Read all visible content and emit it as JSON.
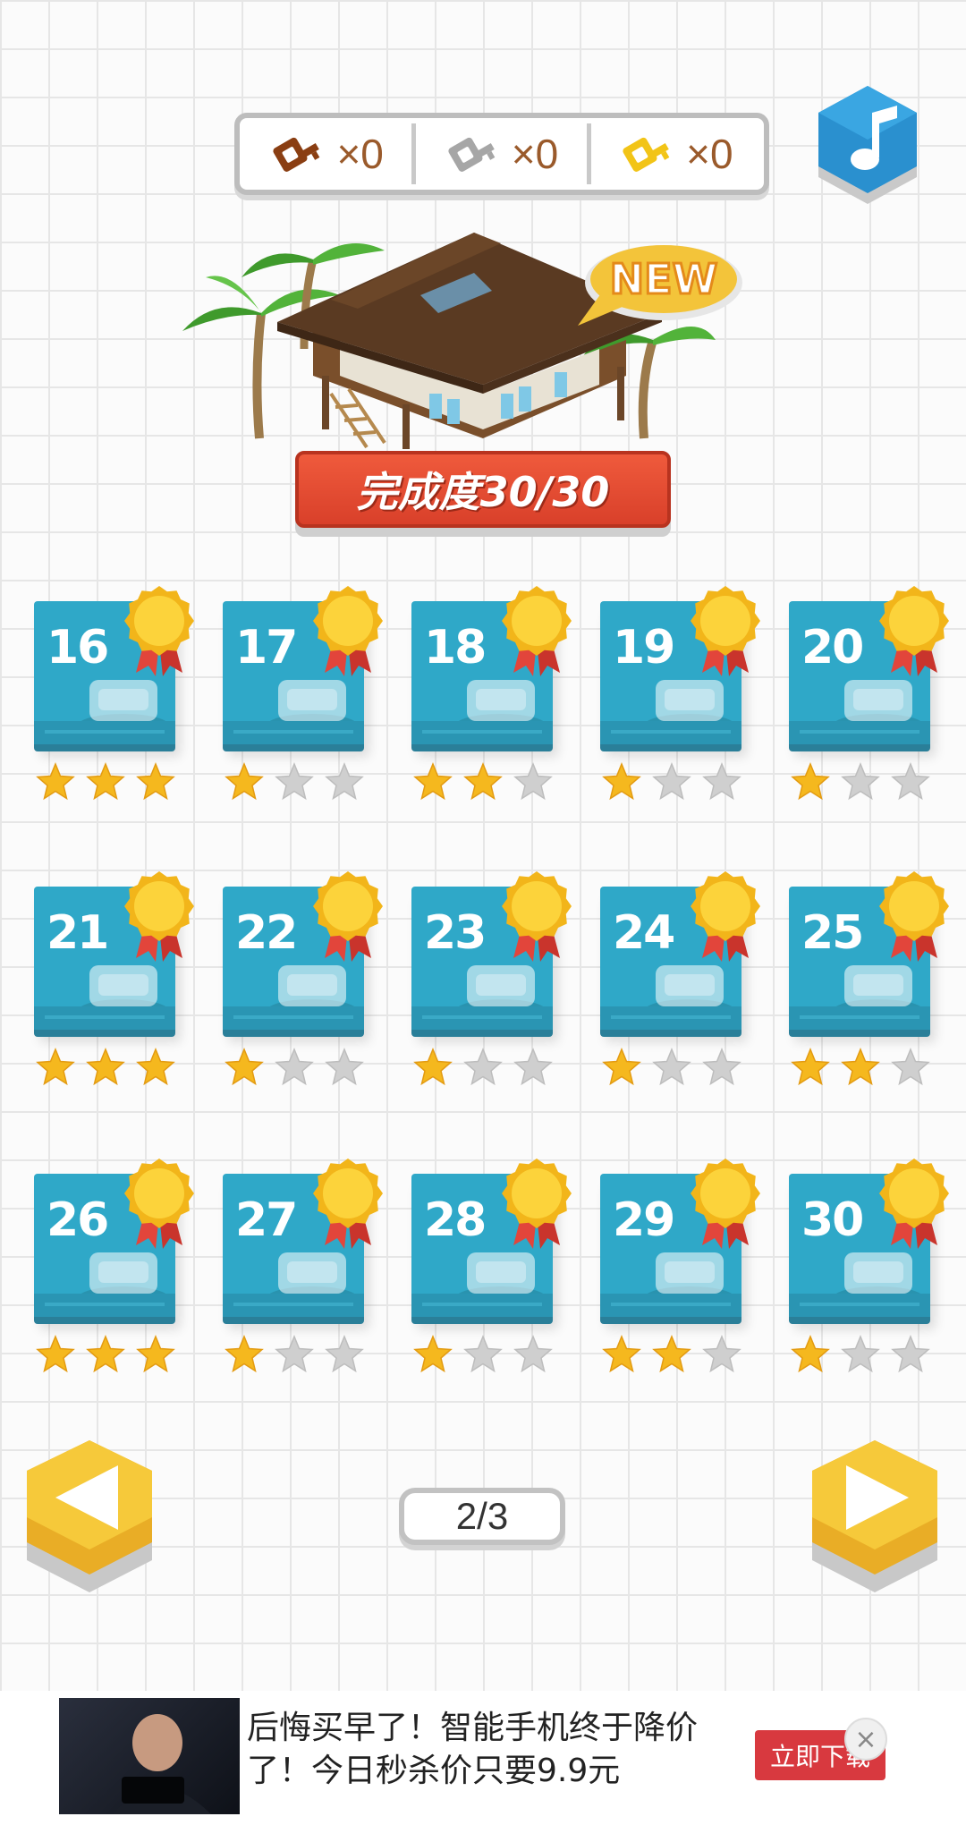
{
  "keys": [
    {
      "name": "bronze-key",
      "count": "×0",
      "color": "#9b4a17",
      "text_color": "#9a5a2b"
    },
    {
      "name": "silver-key",
      "count": "×0",
      "color": "#a8a8a8",
      "text_color": "#9a5a2b"
    },
    {
      "name": "gold-key",
      "count": "×0",
      "color": "#f2c417",
      "text_color": "#9a5a2b"
    }
  ],
  "music_icon": "music-note-icon",
  "house": {
    "badge": "NEW",
    "progress": "完成度30/30"
  },
  "levels": [
    {
      "number": "16",
      "stars": 3,
      "item": "camper-van"
    },
    {
      "number": "17",
      "stars": 1,
      "item": "pineapple-lamp"
    },
    {
      "number": "18",
      "stars": 2,
      "item": "canopy-bed"
    },
    {
      "number": "19",
      "stars": 1,
      "item": "ceiling-fan"
    },
    {
      "number": "20",
      "stars": 1,
      "item": "ukulele"
    },
    {
      "number": "21",
      "stars": 3,
      "item": "helicopter"
    },
    {
      "number": "22",
      "stars": 1,
      "item": "aquarium"
    },
    {
      "number": "23",
      "stars": 1,
      "item": "coconut-drink"
    },
    {
      "number": "24",
      "stars": 1,
      "item": "flip-flop"
    },
    {
      "number": "25",
      "stars": 2,
      "item": "surf-board"
    },
    {
      "number": "26",
      "stars": 3,
      "item": "display-case"
    },
    {
      "number": "27",
      "stars": 1,
      "item": "cactus"
    },
    {
      "number": "28",
      "stars": 1,
      "item": "bottle"
    },
    {
      "number": "29",
      "stars": 2,
      "item": "burger"
    },
    {
      "number": "30",
      "stars": 1,
      "item": "snorkel-mask"
    }
  ],
  "pagination": {
    "label": "2/3"
  },
  "ad": {
    "text": "后悔买早了！智能手机终于降价了！今日秒杀价只要9.9元",
    "cta": "立即下载",
    "close": "×"
  },
  "colors": {
    "tile": "#2fa8c8",
    "star_on": "#f5b81e",
    "star_off": "#cfcfcf",
    "nav": "#f3c43a",
    "banner": "#e0482f"
  }
}
